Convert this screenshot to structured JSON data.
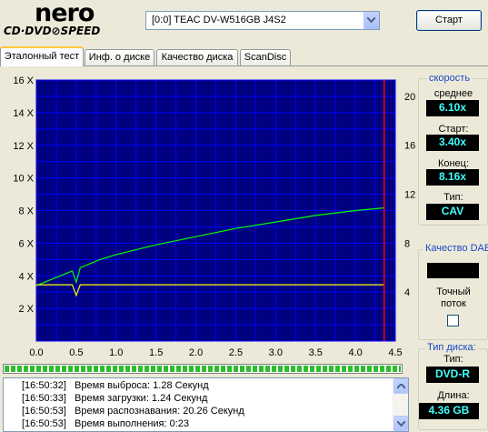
{
  "logo": {
    "brand": "nero",
    "subtitle": "CD·DVD⊘SPEED"
  },
  "drive": {
    "selected": "[0:0]   TEAC DV-W516GB J4S2"
  },
  "toolbar": {
    "start_label": "Старт"
  },
  "tabs": [
    {
      "label": "Эталонный тест",
      "active": true
    },
    {
      "label": "Инф. о диске",
      "active": false
    },
    {
      "label": "Качество диска",
      "active": false
    },
    {
      "label": "ScanDisc",
      "active": false
    }
  ],
  "colors": {
    "plot_bg": "#000080",
    "grid": "#0000ff",
    "read_curve": "#00ff00",
    "cpu_curve": "#ffff00",
    "end_marker": "#ff0000",
    "value_text": "#40ffff"
  },
  "chart_data": {
    "type": "line",
    "xlim": [
      0,
      4.5
    ],
    "x_ticks": [
      "0.0",
      "0.5",
      "1.0",
      "1.5",
      "2.0",
      "2.5",
      "3.0",
      "3.5",
      "4.0",
      "4.5"
    ],
    "y_left_lim": [
      0,
      16
    ],
    "y_left_ticks": [
      "2 X",
      "4 X",
      "6 X",
      "8 X",
      "10 X",
      "12 X",
      "14 X",
      "16 X"
    ],
    "y_right_lim": [
      0,
      21.33
    ],
    "y_right_ticks": [
      "4",
      "8",
      "12",
      "16",
      "20"
    ],
    "grid": true,
    "series": [
      {
        "color": "#00ff00",
        "x": [
          0,
          0.2,
          0.45,
          0.5,
          0.55,
          0.8,
          1.0,
          1.5,
          2.0,
          2.5,
          3.0,
          3.5,
          4.0,
          4.36
        ],
        "y": [
          3.4,
          3.8,
          4.3,
          3.6,
          4.5,
          5.0,
          5.3,
          5.9,
          6.4,
          6.9,
          7.3,
          7.7,
          8.0,
          8.16
        ]
      },
      {
        "color": "#ffff00",
        "x": [
          0,
          0.45,
          0.5,
          0.55,
          1.0,
          2.0,
          3.0,
          4.0,
          4.36
        ],
        "y": [
          3.45,
          3.45,
          2.8,
          3.45,
          3.45,
          3.45,
          3.45,
          3.45,
          3.45
        ]
      }
    ],
    "end_marker_x": 4.36
  },
  "speed": {
    "title": "скорость",
    "avg_label": "среднее",
    "avg_value": "6.10x",
    "start_label": "Старт:",
    "start_value": "3.40x",
    "end_label": "Конец:",
    "end_value": "8.16x",
    "type_label": "Тип:",
    "type_value": "CAV"
  },
  "dae": {
    "title": "Качество DAE",
    "value": "",
    "accurate_stream_label": "Точный поток",
    "accurate_stream_checked": false
  },
  "disc": {
    "title": "Тип диска:",
    "type_label": "Тип:",
    "type_value": "DVD-R",
    "length_label": "Длина:",
    "length_value": "4.36 GB"
  },
  "progress": {
    "fraction": 1.0
  },
  "log": [
    {
      "time": "[16:50:32]",
      "text": "Время выброса: 1.28 Секунд"
    },
    {
      "time": "[16:50:33]",
      "text": "Время загрузки: 1.24 Секунд"
    },
    {
      "time": "[16:50:53]",
      "text": "Время распознавания: 20.26 Секунд"
    },
    {
      "time": "[16:50:53]",
      "text": "Время выполнения:  0:23"
    }
  ]
}
